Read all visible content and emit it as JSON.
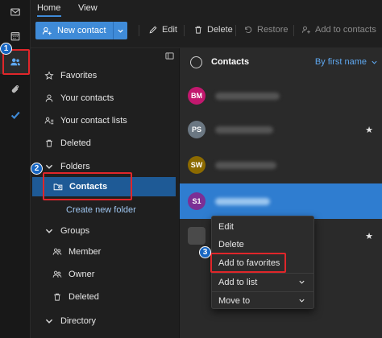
{
  "ribbon": {
    "tabs": [
      "Home",
      "View"
    ],
    "new_contact_label": "New contact",
    "edit_label": "Edit",
    "delete_label": "Delete",
    "restore_label": "Restore",
    "add_to_contacts_label": "Add to contacts"
  },
  "nav": {
    "items": [
      "Favorites",
      "Your contacts",
      "Your contact lists",
      "Deleted"
    ],
    "folders_label": "Folders",
    "contacts_label": "Contacts",
    "create_folder_label": "Create new folder",
    "groups_label": "Groups",
    "group_items": [
      "Member",
      "Owner",
      "Deleted"
    ],
    "directory_label": "Directory"
  },
  "list": {
    "title": "Contacts",
    "sort_label": "By first name",
    "contacts": [
      {
        "initials": "BM",
        "color": "#c2186e",
        "favorite": false
      },
      {
        "initials": "PS",
        "color": "#6b7782",
        "favorite": true
      },
      {
        "initials": "SW",
        "color": "#8c6a00",
        "favorite": false
      },
      {
        "initials": "S1",
        "color": "#7b2f95",
        "favorite": false
      },
      {
        "initials": "",
        "color": "#4a4a4a",
        "favorite": true
      }
    ]
  },
  "context_menu": {
    "items": [
      "Edit",
      "Delete",
      "Add to favorites",
      "Add to list",
      "Move to"
    ]
  },
  "steps": [
    "1",
    "2",
    "3"
  ],
  "colors": {
    "accent": "#3f8bd8",
    "selected_nav": "#1e5a96",
    "selected_row": "#2f7dd0",
    "highlight": "#e0262a"
  }
}
